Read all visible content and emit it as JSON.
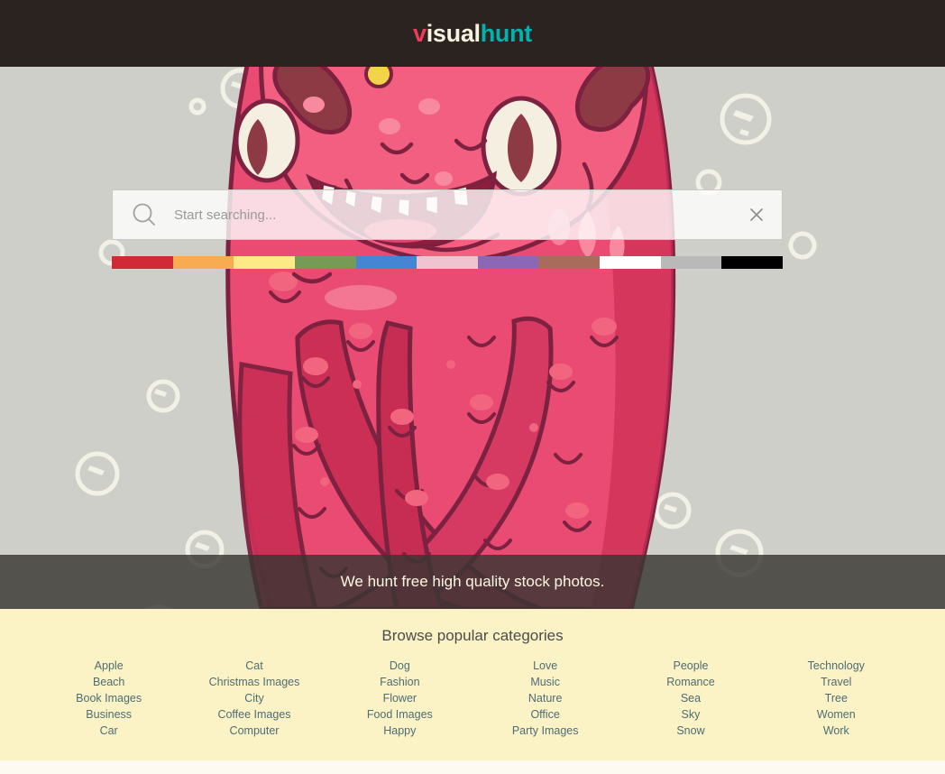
{
  "header": {
    "logo": {
      "part1": "v",
      "part2": "isual",
      "part3": "hunt"
    }
  },
  "hero": {
    "search": {
      "placeholder": "Start searching...",
      "value": "",
      "search_icon": "search-icon",
      "clear_icon": "close-icon"
    },
    "color_filters": [
      {
        "name": "red",
        "hex": "#d02a36"
      },
      {
        "name": "orange",
        "hex": "#f9ab52"
      },
      {
        "name": "yellow",
        "hex": "#fbea86"
      },
      {
        "name": "green",
        "hex": "#769b54"
      },
      {
        "name": "blue",
        "hex": "#4486d4"
      },
      {
        "name": "pink",
        "hex": "#efc3d0"
      },
      {
        "name": "purple",
        "hex": "#8c67b6"
      },
      {
        "name": "brown",
        "hex": "#a96b5b"
      },
      {
        "name": "white",
        "hex": "#ffffff"
      },
      {
        "name": "gray",
        "hex": "#b9b9b9"
      },
      {
        "name": "black",
        "hex": "#000000"
      }
    ],
    "tagline": "We hunt free high quality stock photos."
  },
  "categories": {
    "title": "Browse popular categories",
    "columns": [
      [
        "Apple",
        "Beach",
        "Book Images",
        "Business",
        "Car"
      ],
      [
        "Cat",
        "Christmas Images",
        "City",
        "Coffee Images",
        "Computer"
      ],
      [
        "Dog",
        "Fashion",
        "Flower",
        "Food Images",
        "Happy"
      ],
      [
        "Love",
        "Music",
        "Nature",
        "Office",
        "Party Images"
      ],
      [
        "People",
        "Romance",
        "Sea",
        "Sky",
        "Snow"
      ],
      [
        "Technology",
        "Travel",
        "Tree",
        "Women",
        "Work"
      ]
    ]
  }
}
